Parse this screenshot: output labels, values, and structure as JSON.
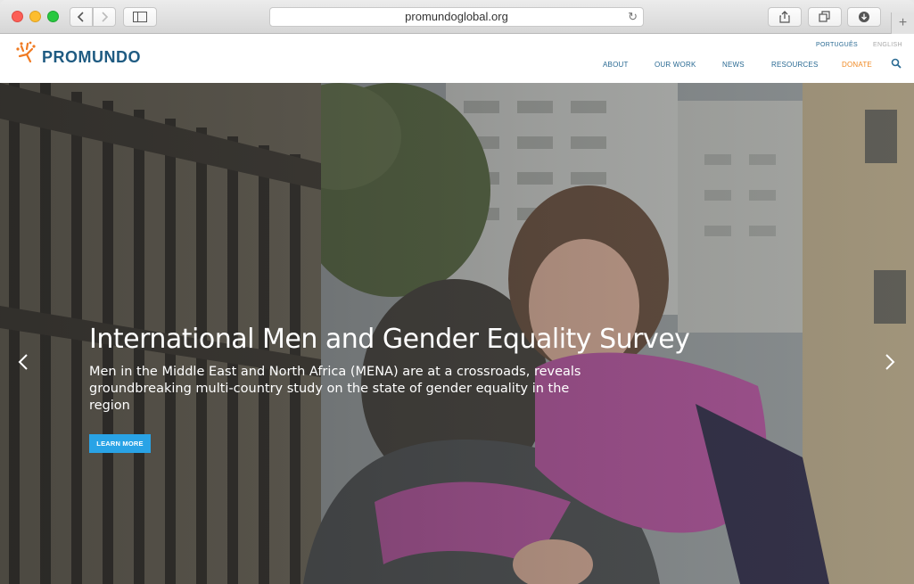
{
  "browser": {
    "url": "promundoglobal.org",
    "icons": {
      "back": "chevron-left-icon",
      "forward": "chevron-right-icon",
      "sidebar": "sidebar-icon",
      "reload": "reload-icon",
      "share": "share-icon",
      "tabs": "tabs-icon",
      "download": "download-icon",
      "new_tab": "plus-icon"
    }
  },
  "site": {
    "logo_text": "PROMUNDO",
    "languages": [
      "PORTUGUÊS",
      "ENGLISH"
    ],
    "nav": {
      "about": "ABOUT",
      "our_work": "OUR WORK",
      "news": "NEWS",
      "resources": "RESOURCES",
      "donate": "DONATE"
    },
    "colors": {
      "brand_blue": "#1f5b82",
      "donate_orange": "#f08a24",
      "button_blue": "#29a3e6"
    }
  },
  "hero": {
    "title": "International Men and Gender Equality Survey",
    "subtitle": "Men in the Middle East and North Africa (MENA) are at a crossroads, reveals groundbreaking multi-country study on the state of gender equality in the region",
    "button_label": "LEARN MORE",
    "prev_icon": "chevron-left-icon",
    "next_icon": "chevron-right-icon"
  }
}
